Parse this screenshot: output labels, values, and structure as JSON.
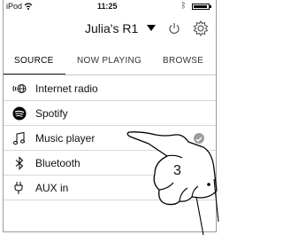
{
  "status": {
    "carrier": "iPod",
    "time": "11:25"
  },
  "header": {
    "device_name": "Julia's R1"
  },
  "tabs": [
    {
      "label": "SOURCE",
      "active": true
    },
    {
      "label": "NOW PLAYING",
      "active": false
    },
    {
      "label": "BROWSE",
      "active": false
    }
  ],
  "sources": [
    {
      "label": "Internet radio",
      "icon": "internet-radio-icon"
    },
    {
      "label": "Spotify",
      "icon": "spotify-icon"
    },
    {
      "label": "Music player",
      "icon": "music-note-icon",
      "selected": true
    },
    {
      "label": "Bluetooth",
      "icon": "bluetooth-icon"
    },
    {
      "label": "AUX in",
      "icon": "aux-plug-icon"
    }
  ],
  "callout": {
    "step": "3"
  },
  "colors": {
    "accent": "#000000",
    "checkmark": "#9d9d9d"
  }
}
